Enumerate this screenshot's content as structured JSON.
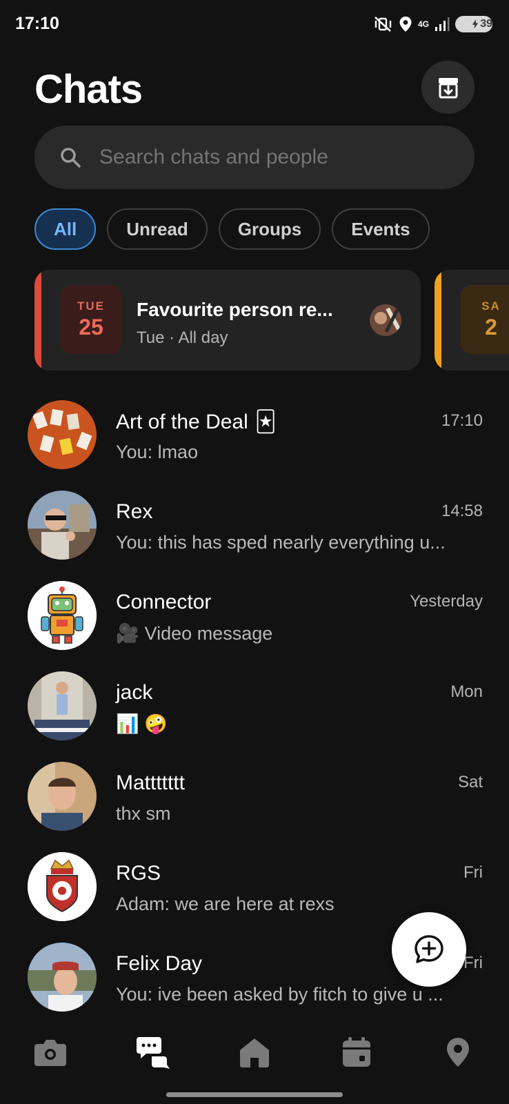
{
  "status_bar": {
    "time": "17:10",
    "network": "4G",
    "battery": "39",
    "icons": [
      "vibrate-off-icon",
      "location-icon",
      "network-4g-icon",
      "signal-icon",
      "battery-charging-icon"
    ]
  },
  "header": {
    "title": "Chats",
    "archive_icon": "archive-icon"
  },
  "search": {
    "placeholder": "Search chats and people"
  },
  "filters": [
    {
      "label": "All",
      "active": true
    },
    {
      "label": "Unread",
      "active": false
    },
    {
      "label": "Groups",
      "active": false
    },
    {
      "label": "Events",
      "active": false
    }
  ],
  "events": [
    {
      "day": "TUE",
      "date": "25",
      "title": "Favourite person re...",
      "subtitle": "Tue · All day",
      "accent": "#e04a3a"
    },
    {
      "day": "SA",
      "date": "2",
      "title": "",
      "subtitle": "",
      "accent": "#f0a023"
    }
  ],
  "chats": [
    {
      "name": "Art of the Deal",
      "name_emoji": "🃏",
      "time": "17:10",
      "preview": "You: lmao"
    },
    {
      "name": "Rex",
      "time": "14:58",
      "preview": "You: this has sped nearly everything u..."
    },
    {
      "name": "Connector",
      "time": "Yesterday",
      "preview_icon": "🎥",
      "preview": "Video message"
    },
    {
      "name": "jack",
      "time": "Mon",
      "preview": "📊 🤪"
    },
    {
      "name": "Mattttttt",
      "time": "Sat",
      "preview": "thx sm"
    },
    {
      "name": "RGS",
      "time": "Fri",
      "preview": "Adam: we are here at rexs"
    },
    {
      "name": "Felix Day",
      "time": "Fri",
      "preview": "You: ive been asked by fitch to give u ..."
    }
  ],
  "fab": {
    "icon": "new-chat-icon"
  },
  "nav": [
    {
      "icon": "camera-icon",
      "active": false
    },
    {
      "icon": "chats-icon",
      "active": true
    },
    {
      "icon": "home-icon",
      "active": false
    },
    {
      "icon": "calendar-icon",
      "active": false
    },
    {
      "icon": "map-pin-icon",
      "active": false
    }
  ],
  "colors": {
    "background": "#121212",
    "surface": "#232323",
    "chip_active_bg": "#16304f",
    "chip_active_border": "#3d8bd8",
    "chip_active_text": "#79b6ff",
    "text_secondary": "#b5b5b5"
  }
}
